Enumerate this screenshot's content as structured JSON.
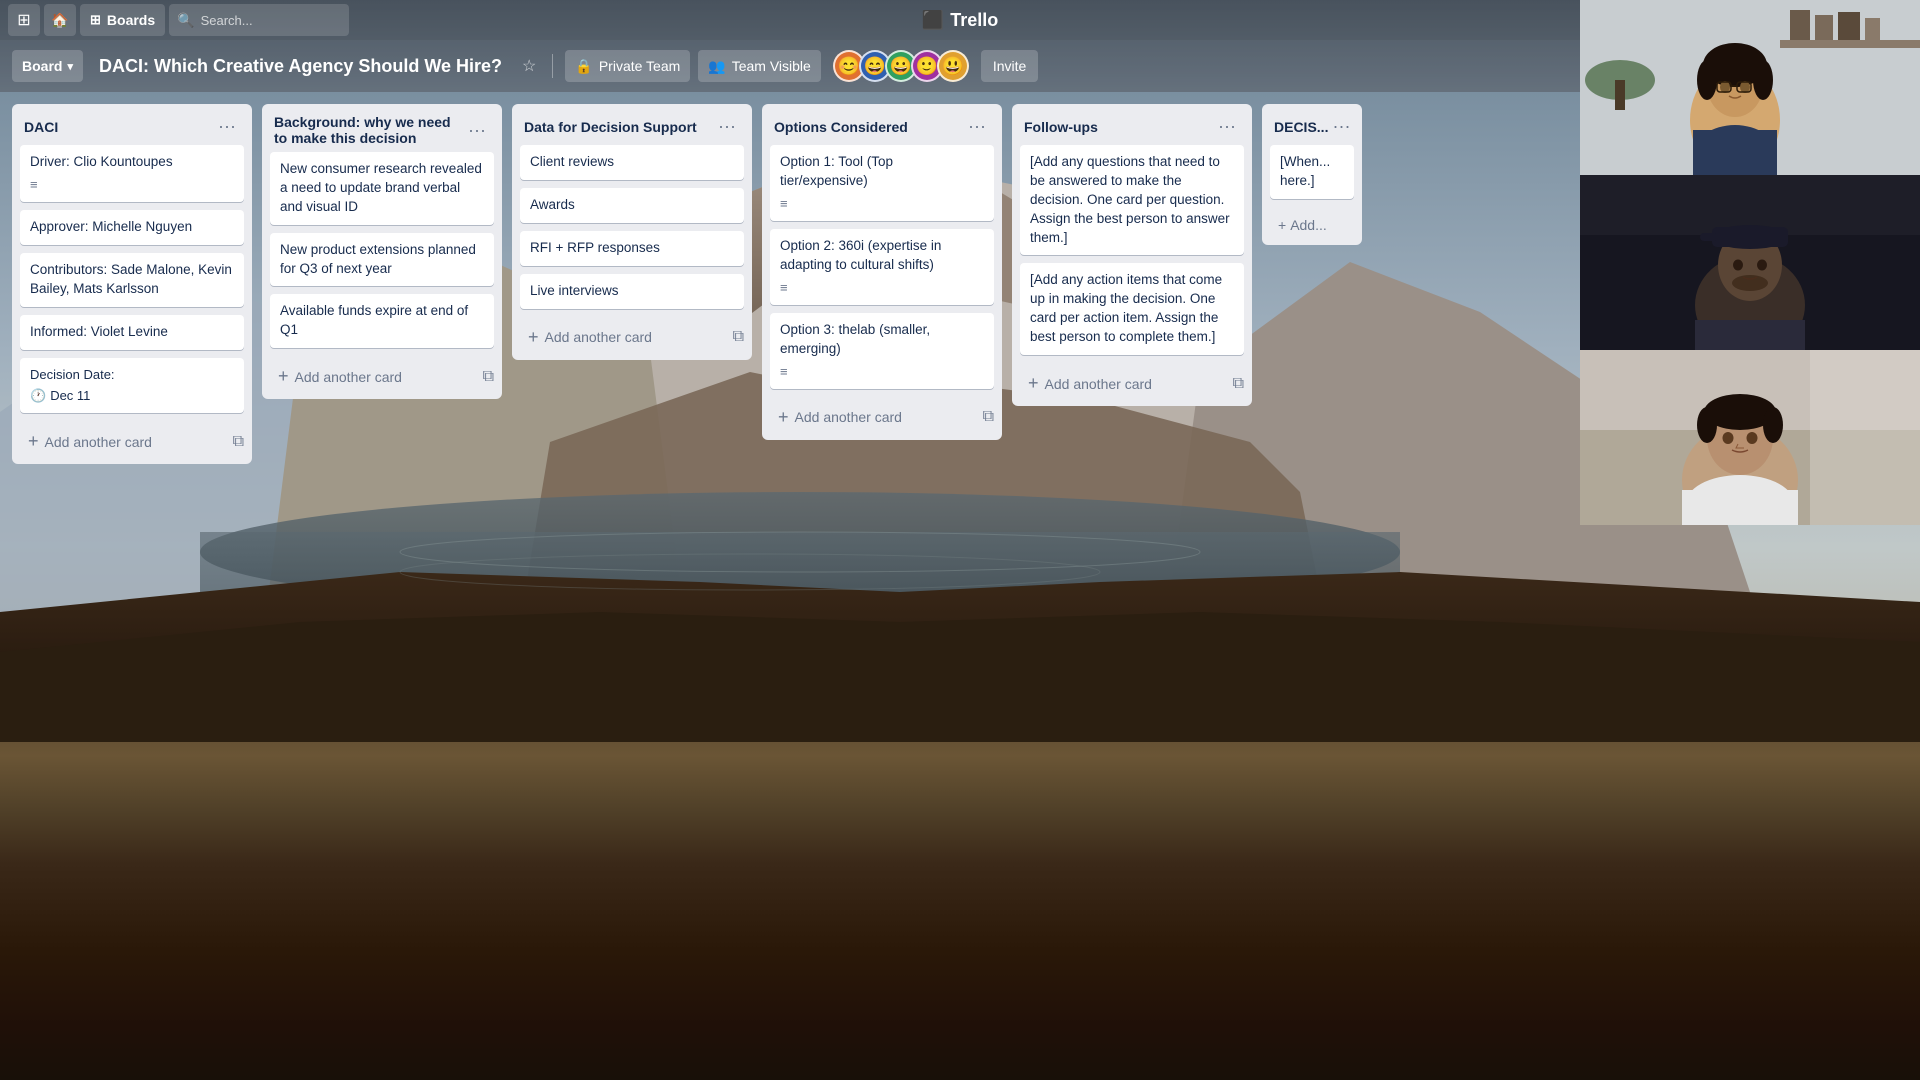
{
  "topbar": {
    "boards_label": "Boards",
    "search_placeholder": "Search...",
    "logo_text": "Trello"
  },
  "board_header": {
    "board_menu_label": "Board",
    "board_title": "DACI: Which Creative Agency Should We Hire?",
    "private_team_label": "Private Team",
    "team_visible_label": "Team Visible",
    "invite_label": "Invite"
  },
  "lists": [
    {
      "id": "daci",
      "title": "DACI",
      "cards": [
        {
          "text": "Driver: Clio Kountoupes",
          "has_icon": true
        },
        {
          "text": "Approver: Michelle Nguyen",
          "has_icon": false
        },
        {
          "text": "Contributors: Sade Malone, Kevin Bailey, Mats Karlsson",
          "has_icon": false
        },
        {
          "text": "Informed: Violet Levine",
          "has_icon": false
        },
        {
          "text": "Decision Date:\n🕐 Dec 11",
          "has_icon": false
        }
      ],
      "add_card_label": "Add another card"
    },
    {
      "id": "background",
      "title": "Background: why we need to make this decision",
      "cards": [
        {
          "text": "New consumer research revealed a need to update brand verbal and visual ID",
          "has_icon": false
        },
        {
          "text": "New product extensions planned for Q3 of next year",
          "has_icon": false
        },
        {
          "text": "Available funds expire at end of Q1",
          "has_icon": false
        }
      ],
      "add_card_label": "Add another card"
    },
    {
      "id": "data",
      "title": "Data for Decision Support",
      "cards": [
        {
          "text": "Client reviews",
          "has_icon": false
        },
        {
          "text": "Awards",
          "has_icon": false
        },
        {
          "text": "RFI + RFP responses",
          "has_icon": false
        },
        {
          "text": "Live interviews",
          "has_icon": false
        }
      ],
      "add_card_label": "Add another card"
    },
    {
      "id": "options",
      "title": "Options Considered",
      "cards": [
        {
          "text": "Option 1: Tool (Top tier/expensive)",
          "has_icon": true
        },
        {
          "text": "Option 2: 360i (expertise in adapting to cultural shifts)",
          "has_icon": true
        },
        {
          "text": "Option 3: thelab (smaller, emerging)",
          "has_icon": true
        }
      ],
      "add_card_label": "Add another card"
    },
    {
      "id": "followups",
      "title": "Follow-ups",
      "cards": [
        {
          "text": "[Add any questions that need to be answered to make the decision. One card per question. Assign the best person to answer them.]",
          "has_icon": false
        },
        {
          "text": "[Add any action items that come up in making the decision. One card per action item. Assign the best person to complete them.]",
          "has_icon": false
        }
      ],
      "add_card_label": "Add another card"
    },
    {
      "id": "decision",
      "title": "DECIS...",
      "cards": [
        {
          "text": "[When decision is made, put it here.]",
          "has_icon": false
        }
      ],
      "add_card_label": "Add..."
    }
  ],
  "avatars": [
    "🧑",
    "👨",
    "👩",
    "🧑",
    "👧"
  ],
  "avatar_colors": [
    "#e07030",
    "#3060b0",
    "#30a060",
    "#a030a0",
    "#e0a030"
  ]
}
